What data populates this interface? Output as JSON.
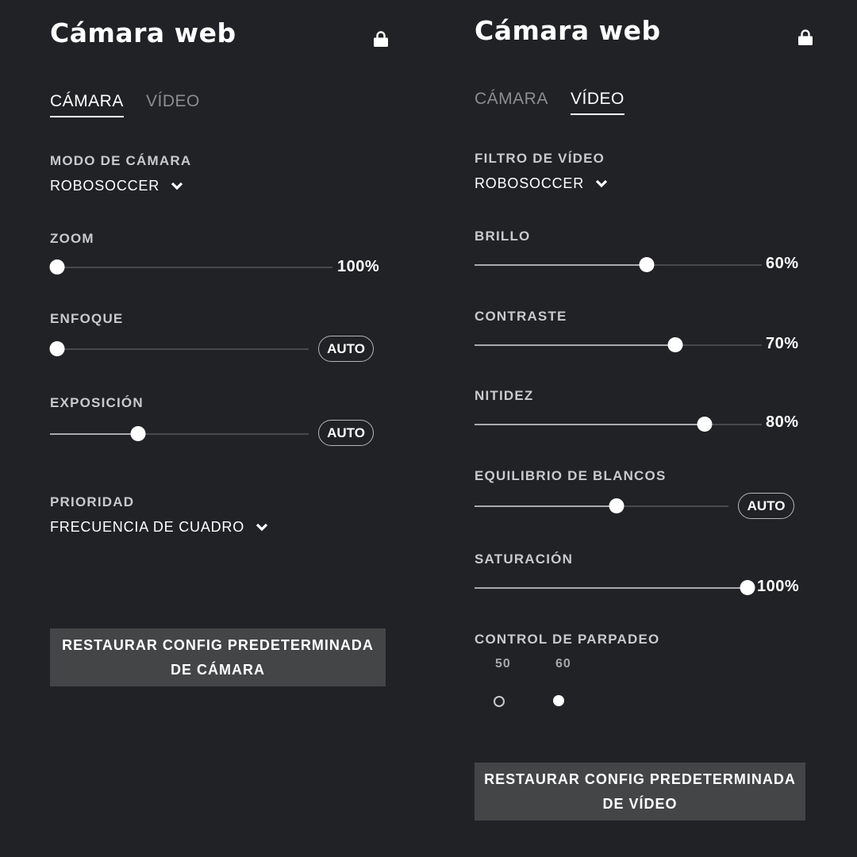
{
  "camera_panel": {
    "title": "Cámara web",
    "tabs": [
      {
        "label": "CÁMARA",
        "active": true
      },
      {
        "label": "VÍDEO",
        "active": false
      }
    ],
    "camera_mode": {
      "label": "MODO DE CÁMARA",
      "value": "ROBOSOCCER"
    },
    "zoom": {
      "label": "ZOOM",
      "value": "100%",
      "level": 0.0
    },
    "focus": {
      "label": "ENFOQUE",
      "level": 0.0,
      "auto_label": "AUTO"
    },
    "exposure": {
      "label": "EXPOSICIÓN",
      "level": 0.34,
      "auto_label": "AUTO"
    },
    "priority": {
      "label": "PRIORIDAD",
      "value": "FRECUENCIA DE CUADRO"
    },
    "reset_line1": "RESTAURAR CONFIG PREDETERMINADA",
    "reset_line2": "DE CÁMARA"
  },
  "video_panel": {
    "title": "Cámara web",
    "tabs": [
      {
        "label": "CÁMARA",
        "active": false
      },
      {
        "label": "VÍDEO",
        "active": true
      }
    ],
    "video_filter": {
      "label": "FILTRO DE VÍDEO",
      "value": "ROBOSOCCER"
    },
    "brightness": {
      "label": "BRILLO",
      "value": "60%",
      "level": 0.6
    },
    "contrast": {
      "label": "CONTRASTE",
      "value": "70%",
      "level": 0.7
    },
    "sharpness": {
      "label": "NITIDEZ",
      "value": "80%",
      "level": 0.8
    },
    "white_balance": {
      "label": "EQUILIBRIO DE BLANCOS",
      "level": 0.56,
      "auto_label": "AUTO"
    },
    "saturation": {
      "label": "SATURACIÓN",
      "value": "100%",
      "level": 1.0
    },
    "flicker": {
      "label": "CONTROL DE PARPADEO",
      "options": [
        {
          "label": "50",
          "selected": false
        },
        {
          "label": "60",
          "selected": true
        }
      ]
    },
    "reset_line1": "RESTAURAR CONFIG PREDETERMINADA",
    "reset_line2": "DE VÍDEO"
  },
  "colors": {
    "background": "#212225",
    "track": "#48494c",
    "track_fill": "#a9aaad",
    "button_bg": "#444547",
    "muted_text": "#8c8d90"
  },
  "icons": [
    "lock-icon",
    "chevron-down-icon"
  ]
}
